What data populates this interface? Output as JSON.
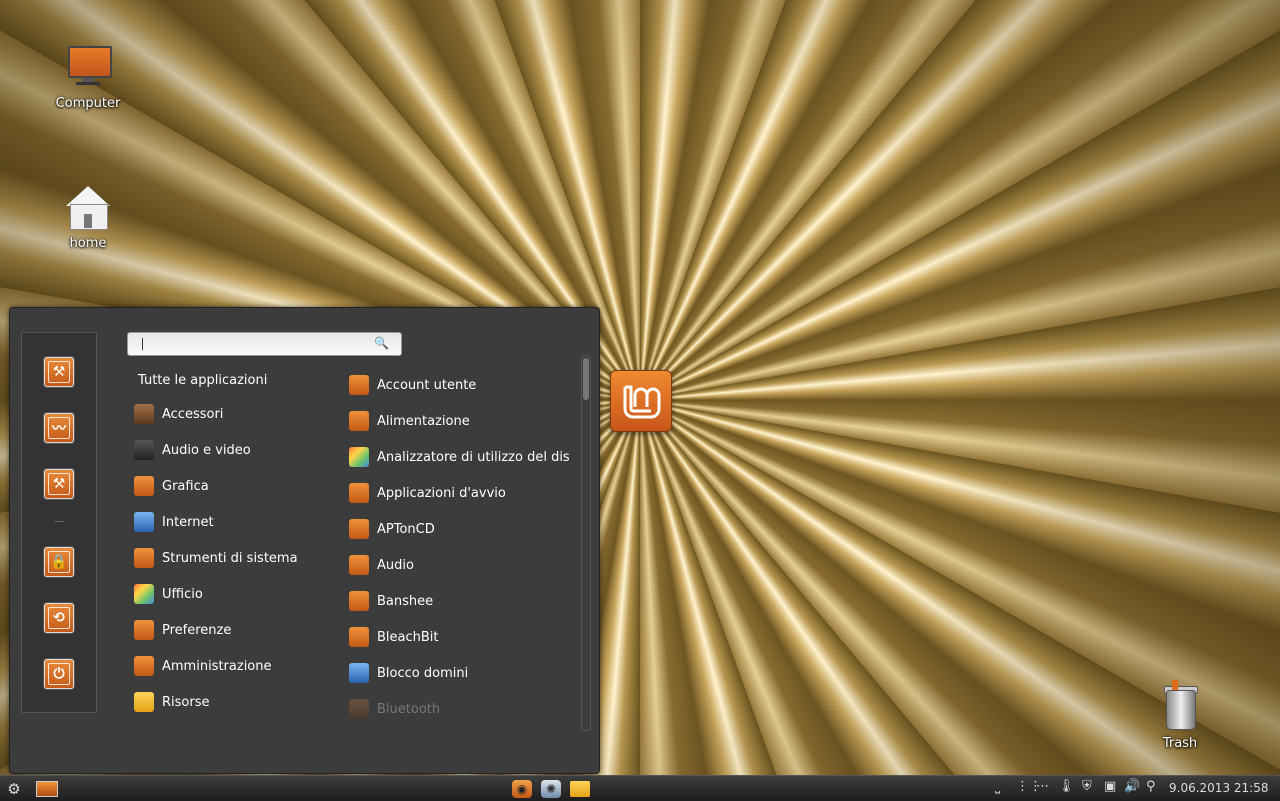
{
  "desktop": {
    "icons": [
      {
        "label": "Computer",
        "icon": "computer-icon"
      },
      {
        "label": "home",
        "icon": "home-folder-icon"
      },
      {
        "label": "Trash",
        "icon": "trash-icon"
      }
    ]
  },
  "menu": {
    "search": {
      "placeholder": "",
      "value": ""
    },
    "favorites": [
      "system-tools-icon",
      "system-monitor-icon",
      "system-tools-icon",
      "lock-icon",
      "logout-icon",
      "power-icon"
    ],
    "categories_title": "Tutte le applicazioni",
    "categories": [
      {
        "label": "Accessori",
        "icon": "accessories-icon"
      },
      {
        "label": "Audio e video",
        "icon": "multimedia-icon"
      },
      {
        "label": "Grafica",
        "icon": "graphics-icon"
      },
      {
        "label": "Internet",
        "icon": "internet-icon"
      },
      {
        "label": "Strumenti di sistema",
        "icon": "system-tools-icon"
      },
      {
        "label": "Ufficio",
        "icon": "office-icon"
      },
      {
        "label": "Preferenze",
        "icon": "preferences-icon"
      },
      {
        "label": "Amministrazione",
        "icon": "administration-icon"
      },
      {
        "label": "Risorse",
        "icon": "folder-icon"
      }
    ],
    "apps": [
      {
        "label": "Account utente",
        "icon": "users-icon"
      },
      {
        "label": "Alimentazione",
        "icon": "power-manager-icon"
      },
      {
        "label": "Analizzatore di utilizzo del dis",
        "icon": "disk-usage-icon"
      },
      {
        "label": "Applicazioni d'avvio",
        "icon": "startup-apps-icon"
      },
      {
        "label": "APTonCD",
        "icon": "aptoncd-icon"
      },
      {
        "label": "Audio",
        "icon": "audio-icon"
      },
      {
        "label": "Banshee",
        "icon": "banshee-icon"
      },
      {
        "label": "BleachBit",
        "icon": "bleachbit-icon"
      },
      {
        "label": "Blocco domini",
        "icon": "domain-blocker-icon"
      },
      {
        "label": "Bluetooth",
        "icon": "bluetooth-icon"
      }
    ]
  },
  "panel": {
    "clock": "9.06.2013  21:58"
  }
}
